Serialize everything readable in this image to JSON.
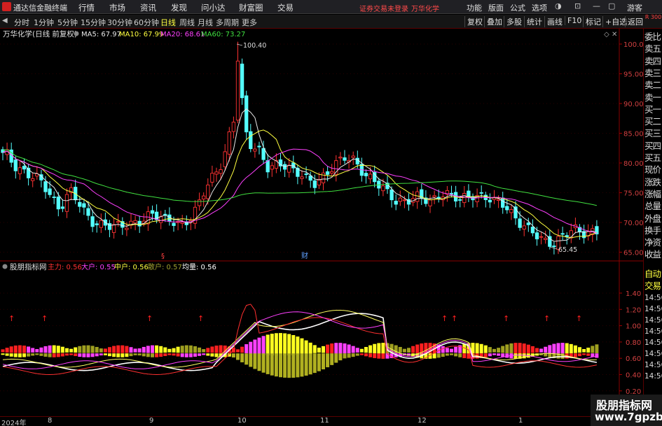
{
  "app": {
    "title": "通达信金融终端",
    "login_status": "证券交易未登录",
    "stock_name": "万华化学",
    "guest": "游客"
  },
  "menus": [
    "行情",
    "市场",
    "资讯",
    "发现",
    "问小达",
    "财富圈",
    "交易"
  ],
  "right_menus": [
    "功能",
    "版面",
    "公式",
    "选项"
  ],
  "periods": [
    "分时",
    "1分钟",
    "5分钟",
    "15分钟",
    "30分钟",
    "60分钟",
    "日线",
    "周线",
    "月线",
    "多周期",
    "更多"
  ],
  "active_period": "日线",
  "toolbar_buttons": [
    "复权",
    "叠加",
    "多股",
    "统计",
    "画线",
    "F10",
    "标记",
    "+自选",
    "返回"
  ],
  "main_chart": {
    "title": "万华化学(日线 前复权)",
    "ma": [
      {
        "label": "MA5: 67.97",
        "color": "#e8e8e8"
      },
      {
        "label": "MA10: 67.99",
        "color": "#ffff40"
      },
      {
        "label": "MA20: 68.61",
        "color": "#ff40ff"
      },
      {
        "label": "MA60: 73.27",
        "color": "#40e040"
      }
    ],
    "y_ticks": [
      "100.0",
      "95.00",
      "90.00",
      "85.00",
      "80.00",
      "75.00",
      "70.00",
      "65.00"
    ],
    "high_label": "100.40",
    "low_label": "65.45",
    "markers": [
      "§",
      "财"
    ]
  },
  "indicator": {
    "name": "股朋指标网",
    "params": [
      {
        "label": "主力: 0.56",
        "color": "#ff3030"
      },
      {
        "label": "大户: 0.55",
        "color": "#ff40ff"
      },
      {
        "label": "中户: 0.56",
        "color": "#ffff40"
      },
      {
        "label": "散户: 0.57",
        "color": "#a0a030"
      },
      {
        "label": "均量: 0.56",
        "color": "#ffffff"
      }
    ],
    "y_ticks": [
      "1.40",
      "1.20",
      "1.00",
      "0.80",
      "0.60",
      "0.40",
      "0.20"
    ]
  },
  "x_axis": [
    "2024年",
    "8",
    "9",
    "10",
    "11",
    "12",
    "1"
  ],
  "right_panel": {
    "badge": "R 300",
    "items": [
      "委比",
      "卖五",
      "卖四",
      "卖三",
      "卖二",
      "卖一",
      "买一",
      "买二",
      "买三",
      "买四",
      "买五",
      "现价",
      "涨跌",
      "涨幅",
      "总量",
      "外盘",
      "换手",
      "净资",
      "收益"
    ],
    "bottom_items": [
      "自动",
      "交易"
    ],
    "times": [
      "14:56",
      "14:56",
      "14:56",
      "14:56",
      "14:56",
      "14:56",
      "14:56",
      "14:56"
    ]
  },
  "watermark": {
    "name": "股朋指标网",
    "url": "www.7gpzb.com"
  }
}
